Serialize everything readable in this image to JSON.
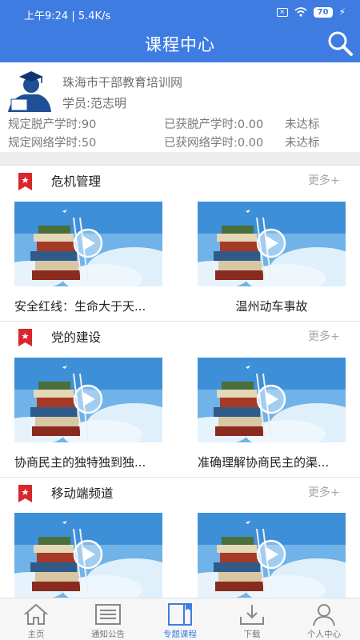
{
  "status_bar": {
    "time": "上午9:24 | 5.4K/s",
    "battery": "70",
    "sim_icon": "x-box-icon",
    "wifi_icon": "wifi-icon",
    "charge_icon": "lightning-icon"
  },
  "header": {
    "title": "课程中心",
    "search_icon": "search-icon"
  },
  "profile": {
    "org": "珠海市干部教育培训网",
    "student": "学员:范志明",
    "required_offline": "规定脱产学时:90",
    "earned_offline": "已获脱产学时:0.00",
    "offline_status": "未达标",
    "required_online": "规定网络学时:50",
    "earned_online": "已获网络学时:0.00",
    "online_status": "未达标"
  },
  "sections": [
    {
      "title": "危机管理",
      "more": "更多+",
      "courses": [
        "安全红线：生命大于天...",
        "温州动车事故"
      ]
    },
    {
      "title": "党的建设",
      "more": "更多+",
      "courses": [
        "协商民主的独特独到独...",
        "准确理解协商民主的渠..."
      ]
    },
    {
      "title": "移动端频道",
      "more": "更多+",
      "courses": [
        "",
        ""
      ]
    }
  ],
  "nav": [
    {
      "label": "主页",
      "icon": "home-icon"
    },
    {
      "label": "通知公告",
      "icon": "notice-icon"
    },
    {
      "label": "专题课程",
      "icon": "book-icon",
      "active": true
    },
    {
      "label": "下载",
      "icon": "download-icon"
    },
    {
      "label": "个人中心",
      "icon": "user-icon"
    }
  ],
  "colors": {
    "brand": "#3f7ce2",
    "flag": "#d9262c"
  }
}
